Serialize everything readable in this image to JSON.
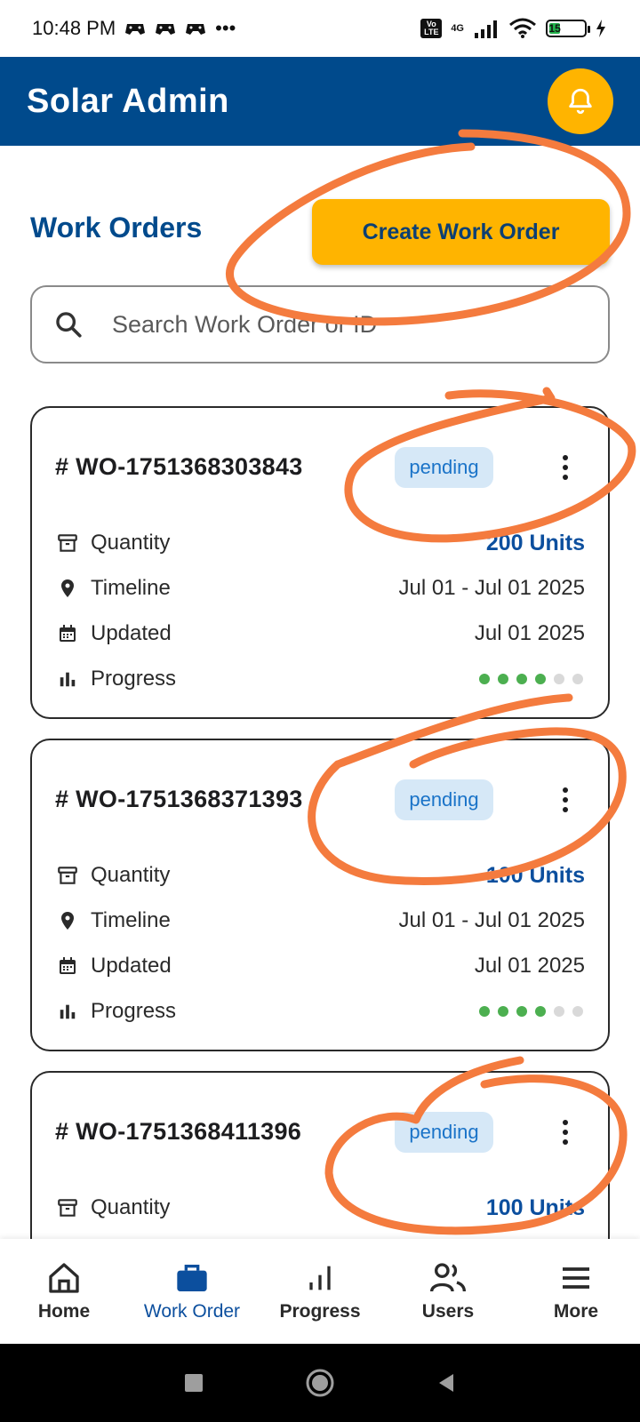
{
  "status_bar": {
    "time": "10:48 PM",
    "more": "•••",
    "network": "4G",
    "volte": "Vo LTE",
    "battery": "15"
  },
  "app_bar": {
    "title": "Solar Admin",
    "bell_icon": "bell-icon"
  },
  "header": {
    "title": "Work Orders",
    "create_button": "Create Work Order"
  },
  "search": {
    "placeholder": "Search Work Order or ID"
  },
  "labels": {
    "quantity": "Quantity",
    "timeline": "Timeline",
    "updated": "Updated",
    "progress": "Progress"
  },
  "cards": [
    {
      "id": "# WO-1751368303843",
      "status": "pending",
      "quantity": "200 Units",
      "timeline": "Jul 01 - Jul 01 2025",
      "updated": "Jul 01 2025",
      "progress_done": 4,
      "progress_total": 6
    },
    {
      "id": "# WO-1751368371393",
      "status": "pending",
      "quantity": "100 Units",
      "timeline": "Jul 01 - Jul 01 2025",
      "updated": "Jul 01 2025",
      "progress_done": 4,
      "progress_total": 6
    },
    {
      "id": "# WO-1751368411396",
      "status": "pending",
      "quantity": "100 Units"
    }
  ],
  "bottom_nav": [
    {
      "label": "Home",
      "icon": "home-icon"
    },
    {
      "label": "Work Order",
      "icon": "briefcase-icon",
      "active": true
    },
    {
      "label": "Progress",
      "icon": "bar-chart-icon"
    },
    {
      "label": "Users",
      "icon": "users-icon"
    },
    {
      "label": "More",
      "icon": "menu-icon"
    }
  ],
  "colors": {
    "primary": "#004a8c",
    "accent": "#ffb400",
    "badge_bg": "#d6e8f7",
    "badge_text": "#1a73c8",
    "progress_on": "#4caf50",
    "progress_off": "#d9d9d9",
    "annotation": "#f47b3e"
  }
}
